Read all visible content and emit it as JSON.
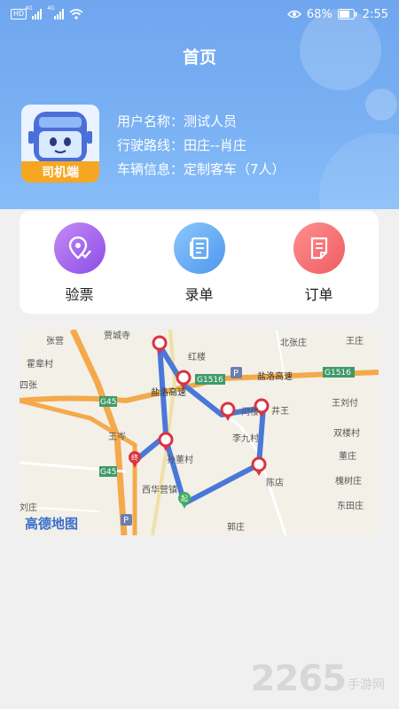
{
  "status_bar": {
    "left_badge": "HD",
    "network_1": "4G",
    "network_2": "4G",
    "battery": "68%",
    "time": "2:55"
  },
  "header": {
    "title": "首页"
  },
  "avatar": {
    "label": "司机端"
  },
  "user": {
    "name_row": "用户名称：测试人员",
    "route_row": "行驶路线：田庄--肖庄",
    "vehicle_row": "车辆信息：定制客车（7人）"
  },
  "menu": [
    {
      "label": "验票",
      "icon": "ticket-check-icon",
      "color_from": "#c58af4",
      "color_to": "#8a4ee8"
    },
    {
      "label": "录单",
      "icon": "document-list-icon",
      "color_from": "#8cc8fb",
      "color_to": "#4e96ee"
    },
    {
      "label": "订单",
      "icon": "order-note-icon",
      "color_from": "#ff8e8e",
      "color_to": "#ef5d63"
    }
  ],
  "map": {
    "logo": "高德地图",
    "places": [
      "张营",
      "贾城寺",
      "北张庄",
      "王庄",
      "霍辈村",
      "红楼",
      "四张",
      "盐洛高速",
      "G1516",
      "G1516",
      "盐洛高速",
      "G45",
      "闫楼",
      "井王",
      "王刘付",
      "王岑",
      "李九村",
      "双楼村",
      "孙董村",
      "董庄",
      "G45",
      "西华营镇",
      "陈店",
      "槐树庄",
      "刘庄",
      "东田庄",
      "郭庄"
    ],
    "start_marker": "起",
    "end_marker": "终"
  },
  "watermark": {
    "number": "2265",
    "suffix": "手游网"
  },
  "colors": {
    "header_top": "#6fa6ee",
    "route": "#4a78d8",
    "stop_pin": "#d9343f",
    "start_pin": "#3fae5c"
  }
}
